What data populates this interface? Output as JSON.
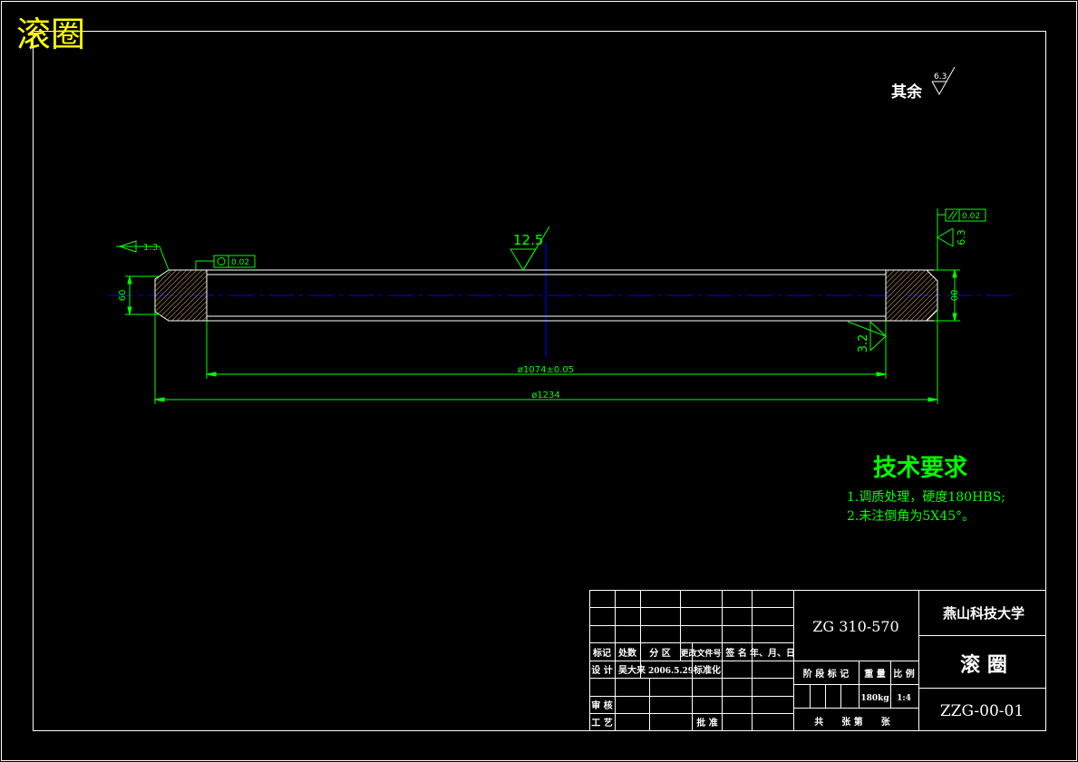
{
  "drawing_title": "滚圈",
  "roughness_default": {
    "label": "其余",
    "value": "6.3"
  },
  "dimensions": {
    "inner_dia": "ø1074±0.05",
    "outer_dia": "ø1234",
    "left_height": "60",
    "right_height": "80",
    "slope": "1:3",
    "roughness_mid": "12.5",
    "roughness_lower": "3.2",
    "roughness_right": "6.3",
    "tol_round": "0.02",
    "tol_parallel": "0.02"
  },
  "tech_req": {
    "heading": "技术要求",
    "items": [
      "1.调质处理，硬度180HBS;",
      "2.未注倒角为5X45°。"
    ]
  },
  "title_block": {
    "material": "ZG 310-570",
    "school": "燕山科技大学",
    "part_name": "滚 圈",
    "drawing_no": "ZZG-00-01",
    "header_labels": [
      "标记",
      "处数",
      "分 区",
      "更改文件号",
      "签 名",
      "年、月、日"
    ],
    "design_label": "设 计",
    "designer": "吴大来",
    "design_date": "2006.5.29",
    "std_label": "标准化",
    "review_label": "审 核",
    "process_label": "工 艺",
    "approve_label": "批 准",
    "stage_label": "阶 段 标 记",
    "weight_label": "重 量",
    "scale_label": "比 例",
    "weight": "180kg",
    "scale": "1:4",
    "sheet_label": "共　　张 第　　张"
  },
  "colors": {
    "frame": "#ffffff",
    "dim": "#00ff00",
    "center": "#0000ff",
    "outline": "#ffffff",
    "hatch": "#c8a060",
    "title": "#ffff00"
  }
}
